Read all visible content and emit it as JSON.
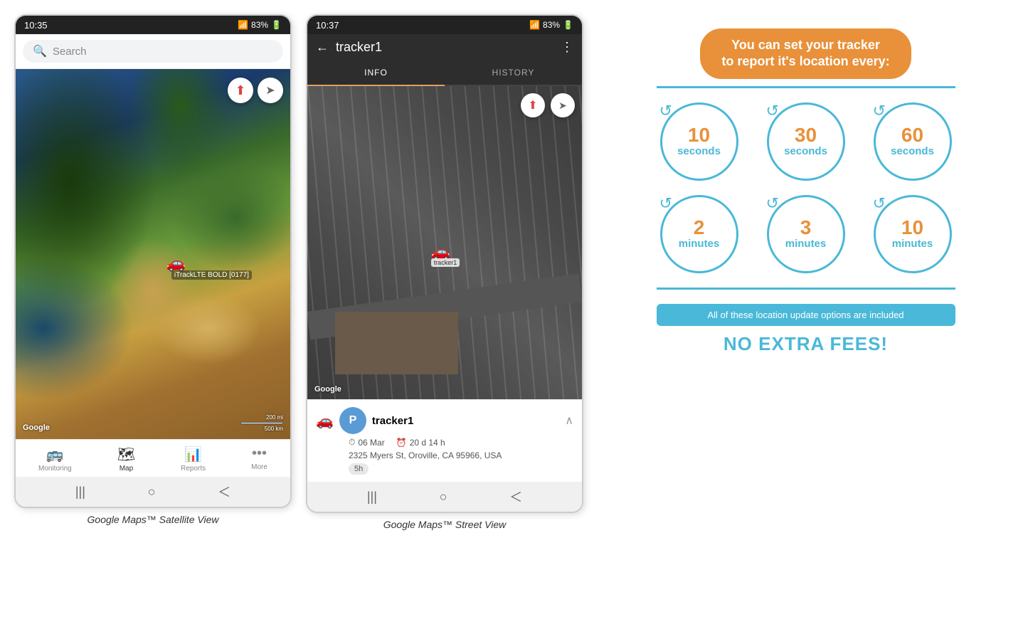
{
  "phone1": {
    "status_time": "10:35",
    "status_battery": "83%",
    "search_placeholder": "Search",
    "compass_icon": "⬆",
    "location_icon": "➤",
    "tracker_label": "iTrackLTE BOLD [0177]",
    "scale_line1": "200 mi",
    "scale_line2": "500 km",
    "google_watermark": "Google",
    "nav": [
      {
        "label": "Monitoring",
        "icon": "🚌",
        "active": false
      },
      {
        "label": "Map",
        "icon": "🗺",
        "active": true
      },
      {
        "label": "Reports",
        "icon": "📊",
        "active": false
      },
      {
        "label": "More",
        "icon": "•••",
        "active": false
      }
    ],
    "caption": "Google Maps™ Satellite View"
  },
  "phone2": {
    "status_time": "10:37",
    "status_battery": "83%",
    "back_icon": "←",
    "title": "tracker1",
    "menu_icon": "⋮",
    "tab_info": "INFO",
    "tab_history": "HISTORY",
    "compass_icon": "⬆",
    "location_icon": "➤",
    "google_watermark": "Google",
    "tracker_car_icon": "🚗",
    "tracker_avatar_letter": "P",
    "tracker_name": "tracker1",
    "tracker_date": "06 Mar",
    "tracker_duration": "20 d 14 h",
    "tracker_address": "2325 Myers St, Oroville, CA 95966, USA",
    "tracker_badge": "5h",
    "tracker_pin_label": "tracker1",
    "caption": "Google Maps™ Street View"
  },
  "info": {
    "headline": "You can set your tracker\nto report it's location every:",
    "blue_line": true,
    "circles": [
      {
        "number": "10",
        "unit": "seconds"
      },
      {
        "number": "30",
        "unit": "seconds"
      },
      {
        "number": "60",
        "unit": "seconds"
      },
      {
        "number": "2",
        "unit": "minutes"
      },
      {
        "number": "3",
        "unit": "minutes"
      },
      {
        "number": "10",
        "unit": "minutes"
      }
    ],
    "included_text": "All of these location update options are included",
    "no_fees_text": "NO EXTRA FEES!"
  }
}
